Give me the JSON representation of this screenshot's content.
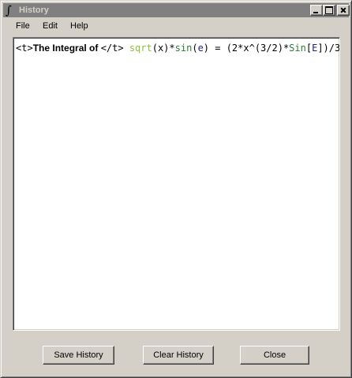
{
  "window": {
    "title": "History",
    "icon": "integral-icon"
  },
  "menu": {
    "file": "File",
    "edit": "Edit",
    "help": "Help"
  },
  "editor": {
    "tokens": [
      {
        "text": "<t>",
        "cls": "t-tag"
      },
      {
        "text": "The Integral of ",
        "cls": "t-text"
      },
      {
        "text": "</t> ",
        "cls": "t-tag"
      },
      {
        "text": "sqrt",
        "cls": "t-fn1"
      },
      {
        "text": "(x)*",
        "cls": "t-plain"
      },
      {
        "text": "sin",
        "cls": "t-fn2"
      },
      {
        "text": "(",
        "cls": "t-plain"
      },
      {
        "text": "e",
        "cls": "t-e"
      },
      {
        "text": ") = (2*x^(3/2)*",
        "cls": "t-plain"
      },
      {
        "text": "Sin",
        "cls": "t-fn2"
      },
      {
        "text": "[",
        "cls": "t-plain"
      },
      {
        "text": "E",
        "cls": "t-e"
      },
      {
        "text": "])/3",
        "cls": "t-plain"
      }
    ]
  },
  "buttons": {
    "save": "Save History",
    "clear": "Clear History",
    "close": "Close"
  }
}
